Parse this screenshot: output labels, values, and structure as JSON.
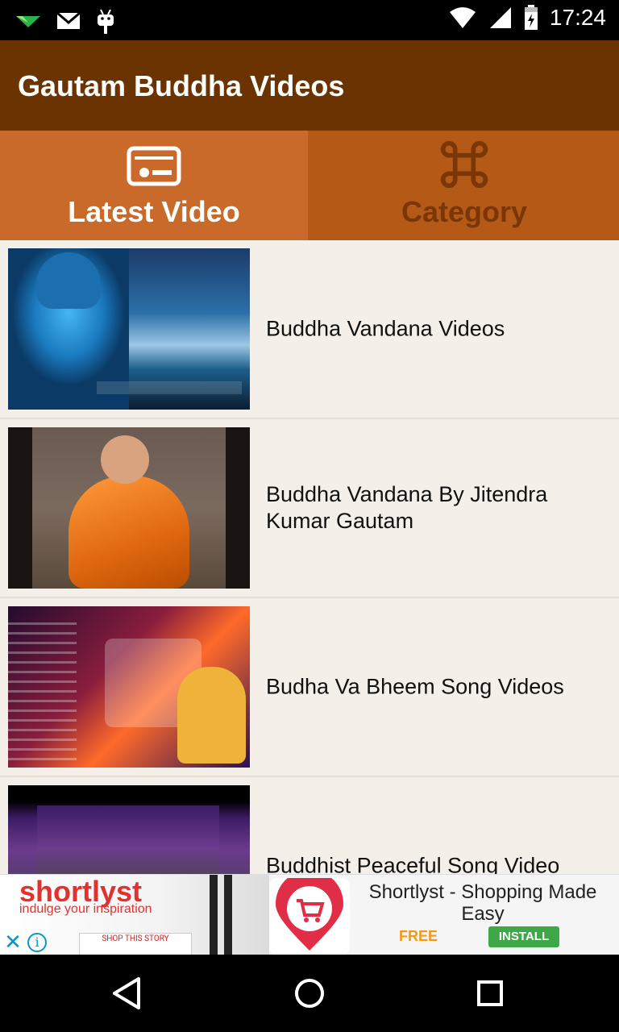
{
  "status_bar": {
    "time": "17:24",
    "icons": [
      "tangram-notification-icon",
      "gmail-icon",
      "android-debug-icon",
      "wifi-icon",
      "cell-signal-icon",
      "battery-icon"
    ]
  },
  "app_bar": {
    "title": "Gautam Buddha Videos"
  },
  "tabs": [
    {
      "label": "Latest Video",
      "icon": "video-card-icon",
      "selected": true
    },
    {
      "label": "Category",
      "icon": "command-icon",
      "selected": false
    }
  ],
  "videos": [
    {
      "title": "Buddha Vandana Videos"
    },
    {
      "title": "Buddha Vandana By Jitendra Kumar Gautam"
    },
    {
      "title": "Budha Va Bheem Song Videos"
    },
    {
      "title": "Buddhist Peaceful Song Video"
    }
  ],
  "ad": {
    "brand": "shortlyst",
    "tagline": "indulge your inspiration",
    "story_label": "SHOP THIS STORY",
    "app_title": "Shortlyst - Shopping Made Easy",
    "price": "FREE",
    "install_label": "INSTALL",
    "close_icon": "close-icon",
    "info_icon": "info-icon"
  },
  "nav_bar": {
    "buttons": [
      "back-icon",
      "home-icon",
      "recents-icon"
    ]
  },
  "colors": {
    "app_bar": "#6b3300",
    "tab_active": "#c96a2a",
    "tab_inactive": "#b45a16",
    "list_bg": "#f4efe8",
    "install_green": "#3ea748",
    "free_orange": "#f29a18"
  }
}
